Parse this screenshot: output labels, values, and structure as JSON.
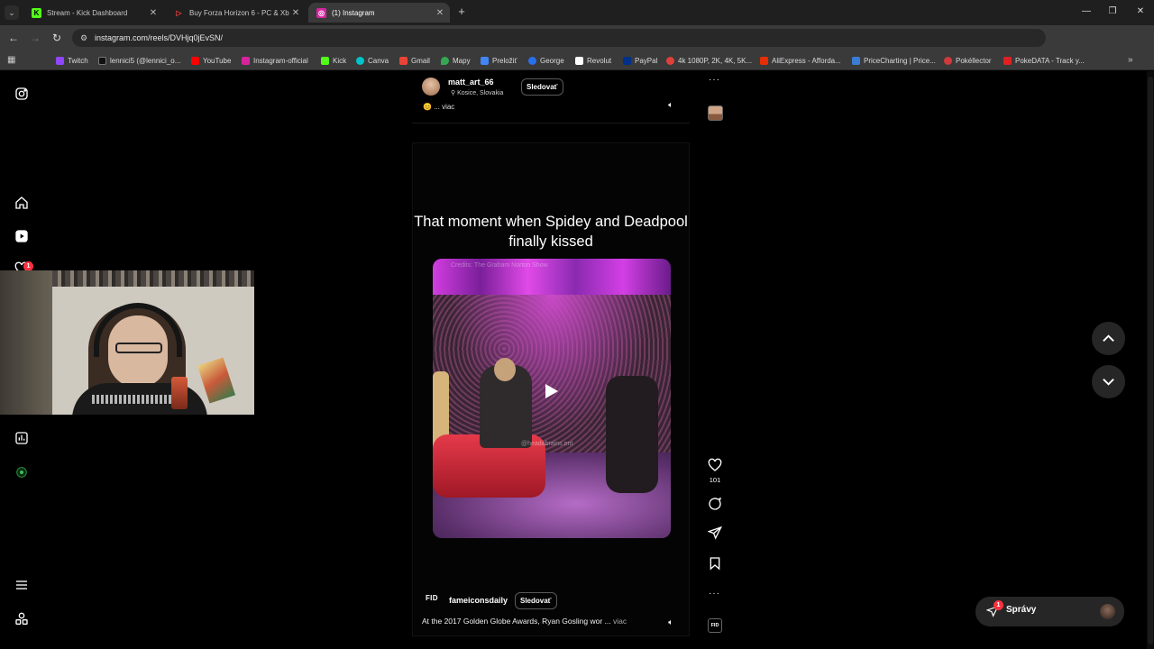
{
  "browser": {
    "tabs": [
      {
        "title": "Stream - Kick Dashboard",
        "favicon_color": "#53fc18",
        "favicon_letter": "K",
        "active": false
      },
      {
        "title": "Buy Forza Horizon 6 - PC & Xb",
        "favicon_color": "#e04040",
        "favicon_letter": "▷",
        "active": false
      },
      {
        "title": "(1) Instagram",
        "favicon_color": "#d6249f",
        "favicon_letter": "◎",
        "active": true
      }
    ],
    "url": "instagram.com/reels/DVHjq0jEvSN/",
    "bookmarks": [
      {
        "label": "Twitch",
        "color": "#9146ff"
      },
      {
        "label": "lennici5 (@lennici_o...",
        "color": "#111111"
      },
      {
        "label": "YouTube",
        "color": "#ff0000"
      },
      {
        "label": "Instagram-official",
        "color": "#d6249f"
      },
      {
        "label": "Kick",
        "color": "#53fc18"
      },
      {
        "label": "Canva",
        "color": "#00c4cc"
      },
      {
        "label": "Gmail",
        "color": "#ea4335"
      },
      {
        "label": "Mapy",
        "color": "#34a853"
      },
      {
        "label": "Preložiť",
        "color": "#4285f4"
      },
      {
        "label": "George",
        "color": "#2870ed"
      },
      {
        "label": "Revolut",
        "color": "#ffffff"
      },
      {
        "label": "PayPal",
        "color": "#003087"
      },
      {
        "label": "4k 1080P, 2K, 4K, 5K...",
        "color": "#e0403a"
      },
      {
        "label": "AliExpress - Afforda...",
        "color": "#e62e04"
      },
      {
        "label": "PriceCharting | Price...",
        "color": "#3a7bd5"
      },
      {
        "label": "Pokéllector",
        "color": "#d03a3a"
      },
      {
        "label": "PokeDATA - Track y...",
        "color": "#e02020"
      }
    ]
  },
  "sidebar": {
    "notification_count": "1"
  },
  "previous_reel": {
    "username": "matt_art_66",
    "location": "Kosice, Slovakia",
    "follow_label": "Sledovať",
    "caption_more": "... viac"
  },
  "reel": {
    "title": "That moment when Spidey and Deadpool finally kissed",
    "video_credit": "Credits: The Graham Norton Show",
    "video_watermark": "@headabrains.ent",
    "account_logo": "FID",
    "username": "fameiconsdaily",
    "follow_label": "Sledovať",
    "caption": "At the 2017 Golden Globe Awards, Ryan Gosling wor ...",
    "caption_more": "viac",
    "likes": "101"
  },
  "messages": {
    "label": "Správy",
    "badge": "1"
  },
  "colors": {
    "background": "#000000",
    "notification": "#ff3040",
    "chrome_tabbar": "#1f1f1f",
    "chrome_toolbar": "#3a3a3a"
  }
}
